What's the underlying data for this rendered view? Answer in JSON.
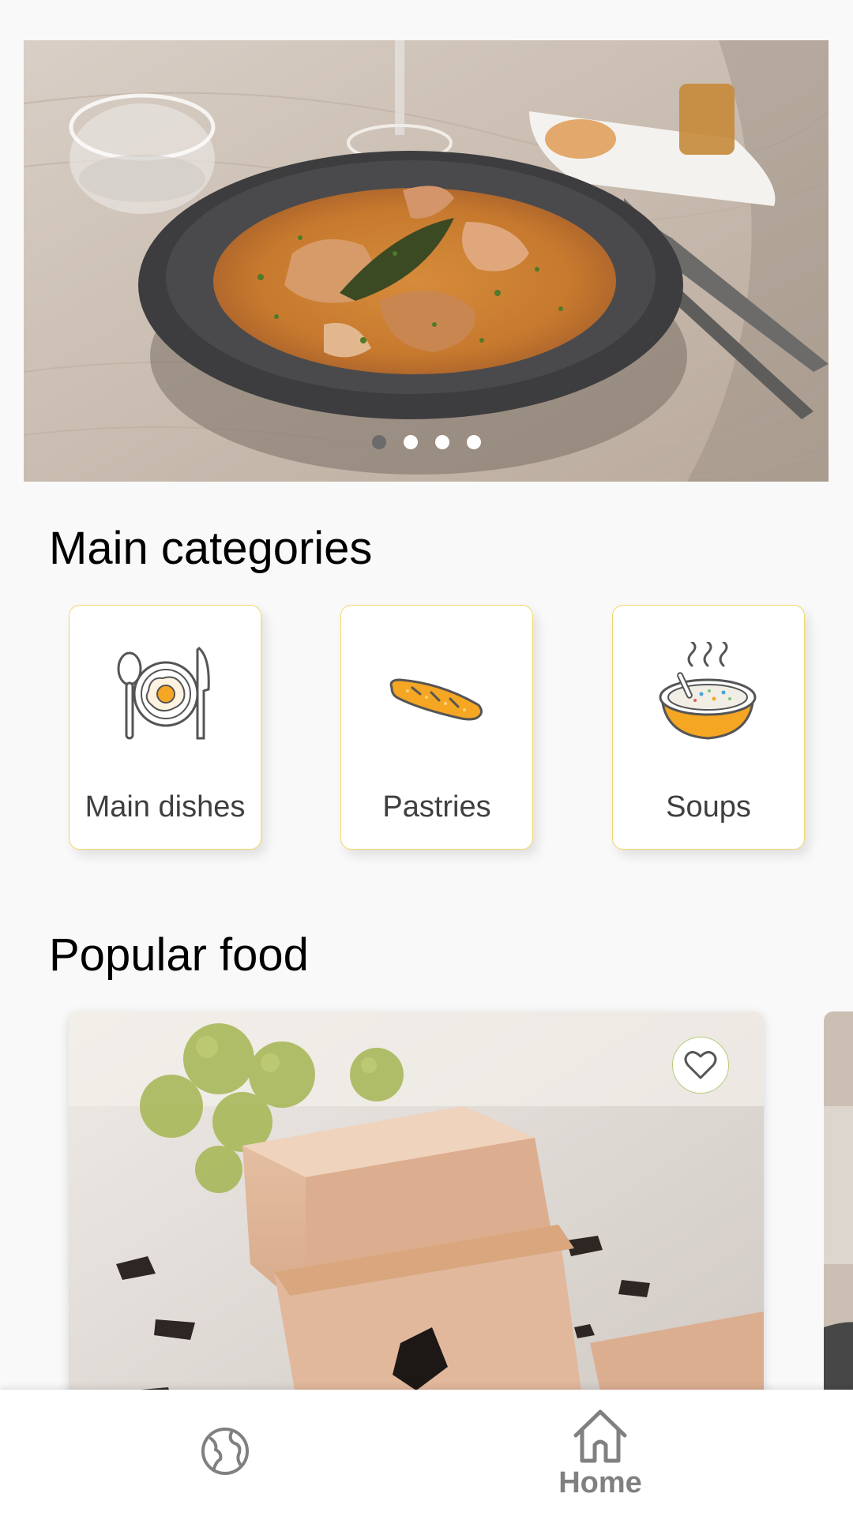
{
  "hero_carousel": {
    "slide_count": 4,
    "active_index": 0,
    "image": "fish-stew-plate-photo"
  },
  "categories": {
    "title": "Main categories",
    "items": [
      {
        "label": "Main dishes",
        "icon": "plate-egg-icon"
      },
      {
        "label": "Pastries",
        "icon": "baguette-icon"
      },
      {
        "label": "Soups",
        "icon": "soup-bowl-icon"
      }
    ]
  },
  "popular": {
    "title": "Popular food",
    "items": [
      {
        "image": "foie-gras-photo",
        "favorite": false
      },
      {
        "image": "dish-photo-partial"
      }
    ]
  },
  "nav": {
    "items": [
      {
        "label": "",
        "icon": "globe-icon",
        "active": false
      },
      {
        "label": "Home",
        "icon": "home-icon",
        "active": true
      }
    ]
  },
  "colors": {
    "background": "#faf9f9",
    "card_border": "#f2d76a",
    "accent_orange": "#f5a623",
    "nav_gray": "#808080",
    "favorite_border": "#b8cc7a"
  }
}
